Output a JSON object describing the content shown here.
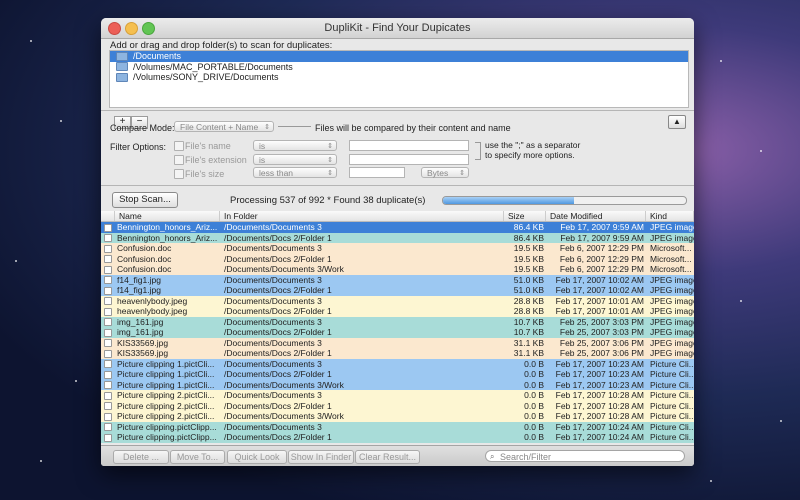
{
  "window": {
    "title": "DupliKit - Find Your Dupicates"
  },
  "source": {
    "prompt": "Add or drag and drop folder(s) to scan for duplicates:",
    "folders": [
      "/Documents",
      "/Volumes/MAC_PORTABLE/Documents",
      "/Volumes/SONY_DRIVE/Documents"
    ],
    "add_label": "+",
    "remove_label": "−",
    "collapse_label": "▲"
  },
  "compare": {
    "label": "Compare Mode:",
    "mode": "File Content + Name",
    "description": "Files will be compared by their content and name"
  },
  "filters": {
    "label": "Filter Options:",
    "name_label": "File's name",
    "name_op": "is",
    "ext_label": "File's extension",
    "ext_op": "is",
    "size_label": "File's size",
    "size_op": "less than",
    "size_unit": "Bytes",
    "hint_line1": "use the \";\" as a separator",
    "hint_line2": "to specify more options."
  },
  "scan": {
    "stop_label": "Stop Scan...",
    "status": "Processing 537 of 992 * Found 38 duplicate(s)",
    "progress": 0.54
  },
  "table": {
    "headers": {
      "name": "Name",
      "folder": "In Folder",
      "size": "Size",
      "date": "Date Modified",
      "kind": "Kind"
    },
    "rows": [
      {
        "name": "Bennington_honors_Ariz...",
        "folder": "/Documents/Documents 3",
        "size": "86.4 KB",
        "date": "Feb 17, 2007 9:59 AM",
        "kind": "JPEG image",
        "color": "#3d80d7",
        "selected": true
      },
      {
        "name": "Bennington_honors_Ariz...",
        "folder": "/Documents/Docs 2/Folder 1",
        "size": "86.4 KB",
        "date": "Feb 17, 2007 9:59 AM",
        "kind": "JPEG image",
        "color": "#a8dcd8",
        "selected": false
      },
      {
        "name": "Confusion.doc",
        "folder": "/Documents/Documents 3",
        "size": "19.5 KB",
        "date": "Feb 6, 2007 12:29 PM",
        "kind": "Microsoft...",
        "color": "#fbe8cf",
        "selected": false
      },
      {
        "name": "Confusion.doc",
        "folder": "/Documents/Docs 2/Folder 1",
        "size": "19.5 KB",
        "date": "Feb 6, 2007 12:29 PM",
        "kind": "Microsoft...",
        "color": "#fbe8cf",
        "selected": false
      },
      {
        "name": "Confusion.doc",
        "folder": "/Documents/Documents 3/Work",
        "size": "19.5 KB",
        "date": "Feb 6, 2007 12:29 PM",
        "kind": "Microsoft...",
        "color": "#fbe8cf",
        "selected": false
      },
      {
        "name": "f14_fig1.jpg",
        "folder": "/Documents/Documents 3",
        "size": "51.0 KB",
        "date": "Feb 17, 2007 10:02 AM",
        "kind": "JPEG image",
        "color": "#9cc8f2",
        "selected": false
      },
      {
        "name": "f14_fig1.jpg",
        "folder": "/Documents/Docs 2/Folder 1",
        "size": "51.0 KB",
        "date": "Feb 17, 2007 10:02 AM",
        "kind": "JPEG image",
        "color": "#9cc8f2",
        "selected": false
      },
      {
        "name": "heavenlybody.jpeg",
        "folder": "/Documents/Documents 3",
        "size": "28.8 KB",
        "date": "Feb 17, 2007 10:01 AM",
        "kind": "JPEG image",
        "color": "#fdf6d2",
        "selected": false
      },
      {
        "name": "heavenlybody.jpeg",
        "folder": "/Documents/Docs 2/Folder 1",
        "size": "28.8 KB",
        "date": "Feb 17, 2007 10:01 AM",
        "kind": "JPEG image",
        "color": "#fdf6d2",
        "selected": false
      },
      {
        "name": "img_161.jpg",
        "folder": "/Documents/Documents 3",
        "size": "10.7 KB",
        "date": "Feb 25, 2007 3:03 PM",
        "kind": "JPEG image",
        "color": "#a8dcd8",
        "selected": false
      },
      {
        "name": "img_161.jpg",
        "folder": "/Documents/Docs 2/Folder 1",
        "size": "10.7 KB",
        "date": "Feb 25, 2007 3:03 PM",
        "kind": "JPEG image",
        "color": "#a8dcd8",
        "selected": false
      },
      {
        "name": "KIS33569.jpg",
        "folder": "/Documents/Documents 3",
        "size": "31.1 KB",
        "date": "Feb 25, 2007 3:06 PM",
        "kind": "JPEG image",
        "color": "#fbe8cf",
        "selected": false
      },
      {
        "name": "KIS33569.jpg",
        "folder": "/Documents/Docs 2/Folder 1",
        "size": "31.1 KB",
        "date": "Feb 25, 2007 3:06 PM",
        "kind": "JPEG image",
        "color": "#fbe8cf",
        "selected": false
      },
      {
        "name": "Picture clipping 1.pictCli...",
        "folder": "/Documents/Documents 3",
        "size": "0.0 B",
        "date": "Feb 17, 2007 10:23 AM",
        "kind": "Picture Cli...",
        "color": "#9cc8f2",
        "selected": false
      },
      {
        "name": "Picture clipping 1.pictCli...",
        "folder": "/Documents/Docs 2/Folder 1",
        "size": "0.0 B",
        "date": "Feb 17, 2007 10:23 AM",
        "kind": "Picture Cli...",
        "color": "#9cc8f2",
        "selected": false
      },
      {
        "name": "Picture clipping 1.pictCli...",
        "folder": "/Documents/Documents 3/Work",
        "size": "0.0 B",
        "date": "Feb 17, 2007 10:23 AM",
        "kind": "Picture Cli...",
        "color": "#9cc8f2",
        "selected": false
      },
      {
        "name": "Picture clipping 2.pictCli...",
        "folder": "/Documents/Documents 3",
        "size": "0.0 B",
        "date": "Feb 17, 2007 10:28 AM",
        "kind": "Picture Cli...",
        "color": "#fdf6d2",
        "selected": false
      },
      {
        "name": "Picture clipping 2.pictCli...",
        "folder": "/Documents/Docs 2/Folder 1",
        "size": "0.0 B",
        "date": "Feb 17, 2007 10:28 AM",
        "kind": "Picture Cli...",
        "color": "#fdf6d2",
        "selected": false
      },
      {
        "name": "Picture clipping 2.pictCli...",
        "folder": "/Documents/Documents 3/Work",
        "size": "0.0 B",
        "date": "Feb 17, 2007 10:28 AM",
        "kind": "Picture Cli...",
        "color": "#fdf6d2",
        "selected": false
      },
      {
        "name": "Picture clipping.pictClipp...",
        "folder": "/Documents/Documents 3",
        "size": "0.0 B",
        "date": "Feb 17, 2007 10:24 AM",
        "kind": "Picture Cli...",
        "color": "#a8dcd8",
        "selected": false
      },
      {
        "name": "Picture clipping.pictClipp...",
        "folder": "/Documents/Docs 2/Folder 1",
        "size": "0.0 B",
        "date": "Feb 17, 2007 10:24 AM",
        "kind": "Picture Cli...",
        "color": "#a8dcd8",
        "selected": false
      }
    ]
  },
  "bottom": {
    "delete_label": "Delete ...",
    "move_label": "Move To...",
    "quicklook_label": "Quick Look",
    "finder_label": "Show In Finder",
    "clear_label": "Clear Result...",
    "search_placeholder": "Search/Filter"
  }
}
